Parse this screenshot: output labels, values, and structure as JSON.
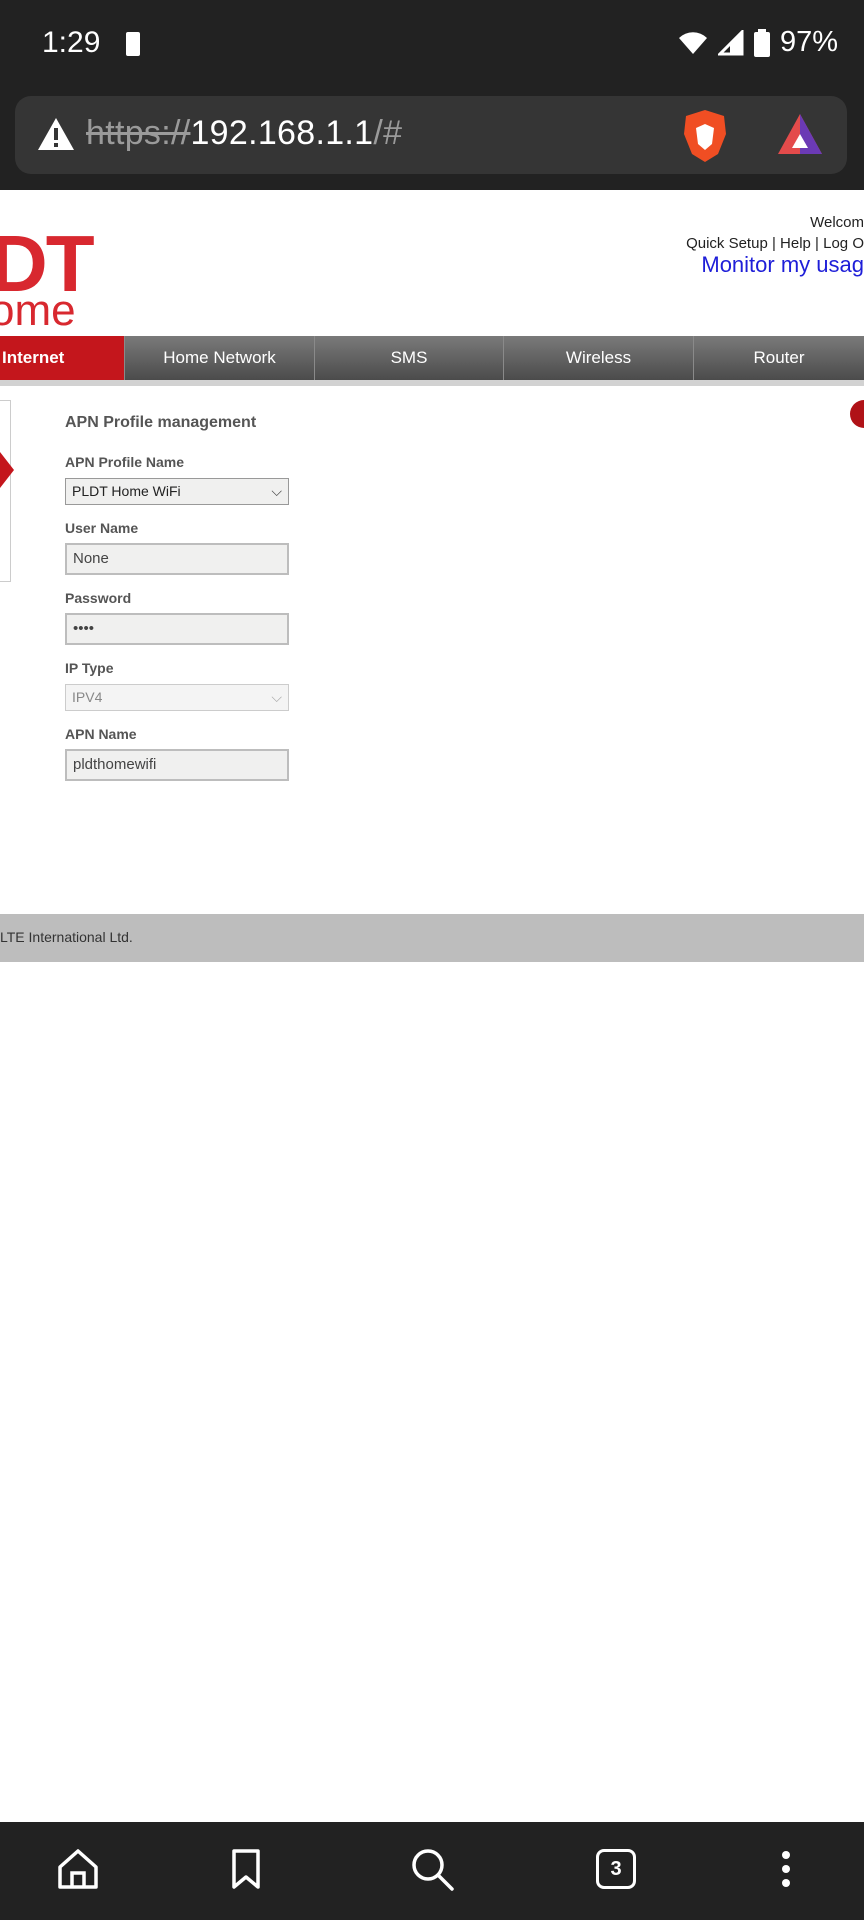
{
  "status_bar": {
    "time": "1:29",
    "battery": "97%"
  },
  "browser": {
    "url_scheme": "https://",
    "url_host": "192.168.1.1",
    "url_path": "/#"
  },
  "header": {
    "logo_top": "DT",
    "logo_bottom": "ome",
    "welcome": "Welcom",
    "quick_setup": "Quick Setup",
    "help": "Help",
    "logout": "Log O",
    "monitor": "Monitor my usag"
  },
  "nav": {
    "items": [
      {
        "label": "Internet"
      },
      {
        "label": "Home Network"
      },
      {
        "label": "SMS"
      },
      {
        "label": "Wireless"
      },
      {
        "label": "Router"
      }
    ]
  },
  "form": {
    "title": "APN Profile management",
    "profile_name_label": "APN Profile Name",
    "profile_name_value": "PLDT Home WiFi",
    "username_label": "User Name",
    "username_value": "None",
    "password_label": "Password",
    "password_value": "••••",
    "ip_type_label": "IP Type",
    "ip_type_value": "IPV4",
    "apn_name_label": "APN Name",
    "apn_name_value": "pldthomewifi"
  },
  "footer": {
    "text": "LTE International Ltd."
  },
  "toolbar": {
    "tabs_count": "3"
  },
  "colors": {
    "brand_red": "#c4161c",
    "link_blue": "#1e1ed8"
  }
}
